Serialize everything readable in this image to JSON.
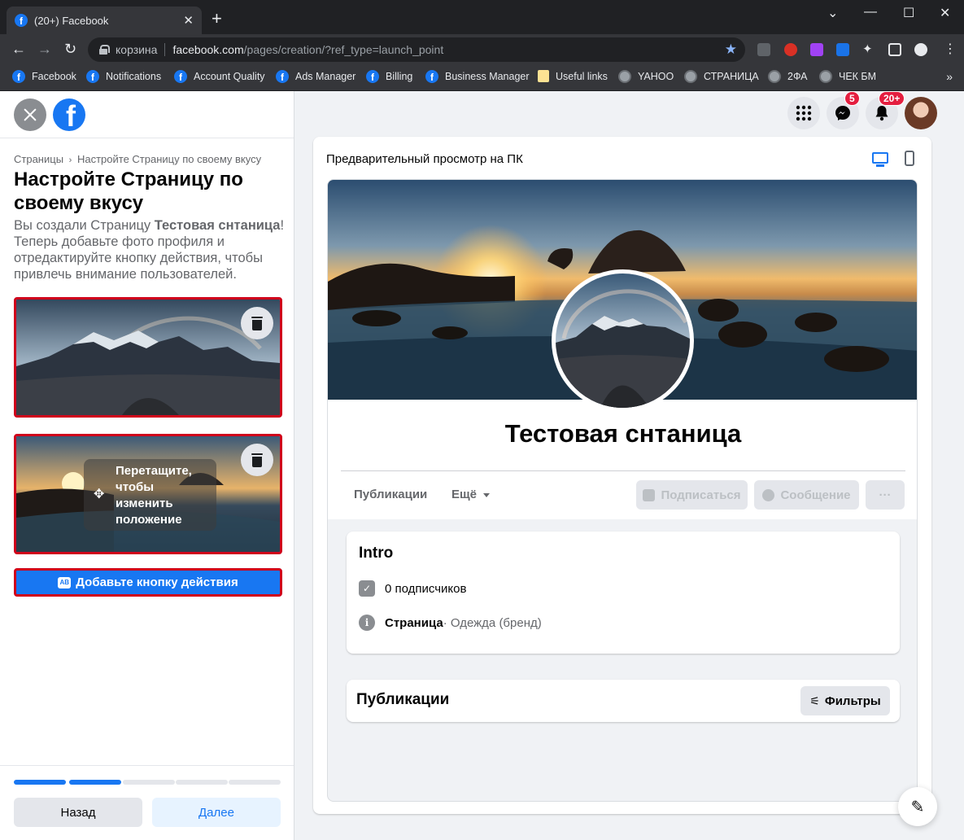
{
  "browser": {
    "tab_title": "(20+) Facebook",
    "url_chip": "корзина",
    "url_host": "facebook.com",
    "url_path": "/pages/creation/?ref_type=launch_point",
    "bookmarks": [
      {
        "label": "Facebook",
        "icon": "facebook-icon"
      },
      {
        "label": "Notifications",
        "icon": "facebook-icon"
      },
      {
        "label": "Account Quality",
        "icon": "facebook-icon"
      },
      {
        "label": "Ads Manager",
        "icon": "facebook-icon"
      },
      {
        "label": "Billing",
        "icon": "facebook-icon"
      },
      {
        "label": "Business Manager",
        "icon": "facebook-icon"
      },
      {
        "label": "Useful links",
        "icon": "folder-icon"
      },
      {
        "label": "YAHOO",
        "icon": "globe-icon"
      },
      {
        "label": "СТРАНИЦА",
        "icon": "globe-icon"
      },
      {
        "label": "2ФА",
        "icon": "globe-icon"
      },
      {
        "label": "ЧЕК БМ",
        "icon": "globe-icon"
      }
    ]
  },
  "left": {
    "breadcrumb_root": "Страницы",
    "breadcrumb_sep": "›",
    "breadcrumb_current": "Настройте Страницу по своему вкусу",
    "title": "Настройте Страницу по своему вкусу",
    "desc_before": "Вы создали Страницу ",
    "desc_page": "Тестовая снтаница",
    "desc_after": "! Теперь добавьте фото профиля и отредактируйте кнопку действия, чтобы привлечь внимание пользователей.",
    "drag_tip": "Перетащите, чтобы изменить положение",
    "action_button": "Добавьте кнопку действия",
    "progress": {
      "completed_steps": 2,
      "total_steps": 5
    },
    "back_button": "Назад",
    "next_button": "Далее"
  },
  "header": {
    "messenger_badge": "5",
    "notifications_badge": "20+"
  },
  "preview": {
    "title": "Предварительный просмотр на ПК",
    "page_name": "Тестовая снтаница",
    "tab_posts": "Публикации",
    "tab_more": "Ещё",
    "subscribe_button": "Подписаться",
    "message_button": "Сообщение",
    "more_button": "···",
    "intro_title": "Intro",
    "followers": "0 подписчиков",
    "category_bold": "Страница",
    "category_rest": " · Одежда (бренд)",
    "posts_title": "Публикации",
    "filters_button": "Фильтры"
  },
  "colors": {
    "accent": "#1877f2",
    "highlight_border": "#d0011b",
    "badge": "#e41e3f"
  }
}
